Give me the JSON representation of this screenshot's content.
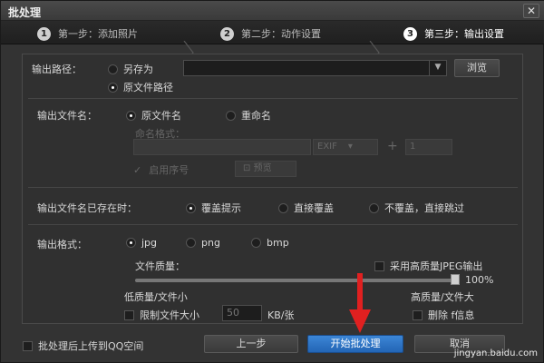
{
  "window": {
    "title": "批处理",
    "close_glyph": "✕"
  },
  "steps": [
    {
      "num": "1",
      "label": "第一步：添加照片"
    },
    {
      "num": "2",
      "label": "第二步：动作设置"
    },
    {
      "num": "3",
      "label": "第三步：输出设置"
    }
  ],
  "output_path": {
    "label": "输出路径：",
    "option_save_as": "另存为",
    "option_original": "原文件路径",
    "browse": "浏览",
    "path_value": ""
  },
  "output_name": {
    "label": "输出文件名：",
    "option_original": "原文件名",
    "option_rename": "重命名",
    "naming_format": "命名格式：",
    "exif": "EXIF",
    "plus": "+",
    "start_value": "1",
    "sequence": "启用序号",
    "preview": "预览"
  },
  "exists": {
    "label": "输出文件名已存在时：",
    "option_prompt": "覆盖提示",
    "option_overwrite": "直接覆盖",
    "option_skip": "不覆盖，直接跳过"
  },
  "format": {
    "label": "输出格式：",
    "opt_jpg": "jpg",
    "opt_png": "png",
    "opt_bmp": "bmp",
    "quality_label": "文件质量：",
    "hq_jpeg": "采用高质量JPEG输出",
    "quality_value": "100%",
    "quality_level": 100,
    "low_label": "低质量/文件小",
    "high_label": "高质量/文件大",
    "limit_size": "限制文件大小",
    "size_value": "50",
    "size_unit": "KB/张",
    "delete_info": "删除     f信息"
  },
  "footer": {
    "upload_qq": "批处理后上传到QQ空间",
    "prev": "上一步",
    "start": "开始批处理",
    "cancel": "取消"
  },
  "watermark": "jingyan.baidu.com",
  "colors": {
    "accent": "#2f78c8",
    "arrow": "#e02020"
  }
}
